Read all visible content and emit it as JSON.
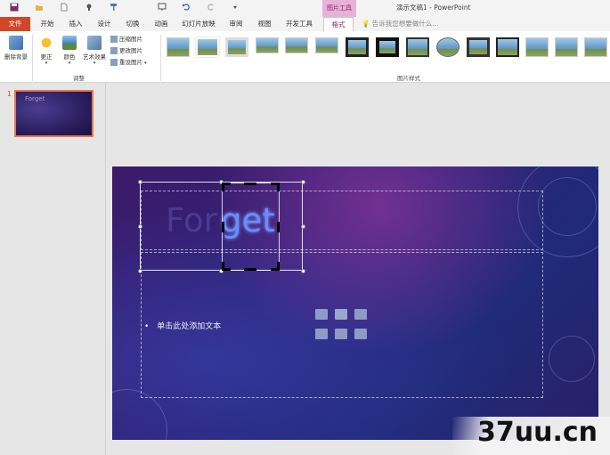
{
  "window": {
    "title": "演示文稿1 - PowerPoint",
    "contextual_tab_group": "图片工具"
  },
  "quick_access": [
    "save-icon",
    "open-icon",
    "new-icon",
    "touch-mode-icon",
    "format-painter-icon",
    "present-icon",
    "undo-icon",
    "redo-icon",
    "customize-icon"
  ],
  "tabs": {
    "file": "文件",
    "home": "开始",
    "insert": "插入",
    "design": "设计",
    "transitions": "切换",
    "animations": "动画",
    "slideshow": "幻灯片放映",
    "review": "审阅",
    "view": "视图",
    "developer": "开发工具",
    "format": "格式"
  },
  "tell_me": {
    "placeholder": "告诉我您想要做什么..."
  },
  "ribbon": {
    "remove_background": "删除背景",
    "corrections": "更正",
    "color": "颜色",
    "artistic_effects": "艺术效果",
    "compress_pictures": "压缩图片",
    "change_picture": "更改图片",
    "reset_picture": "重设图片",
    "group_adjust": "调整",
    "group_picture_styles": "图片样式"
  },
  "slide_panel": {
    "slide_number": "1",
    "thumbnail_text": "Forget"
  },
  "slide": {
    "title_text_main": "For",
    "title_text_cropped": "get",
    "content_placeholder": "单击此处添加文本",
    "bullet": "•"
  },
  "watermark": {
    "text": "37uu.cn"
  },
  "colors": {
    "file_tab": "#d24726",
    "contextual_tab": "#e8b1d8",
    "accent": "#8a1f6b"
  }
}
